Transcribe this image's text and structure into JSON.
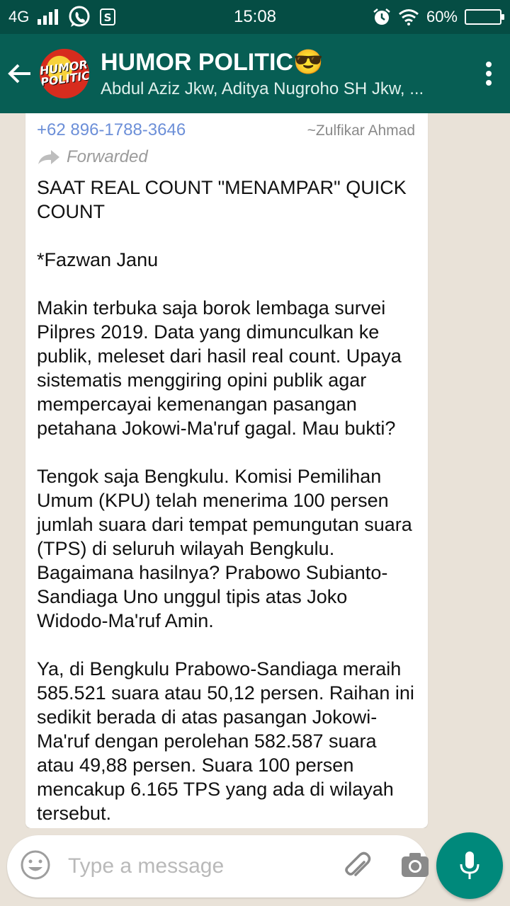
{
  "status_bar": {
    "network": "4G",
    "time": "15:08",
    "battery": "60%"
  },
  "header": {
    "avatar_text": "HUMOR POLITIC",
    "title": "HUMOR POLITIC😎",
    "subtitle": "Abdul Aziz Jkw, Aditya Nugroho SH Jkw, ..."
  },
  "message": {
    "sender_phone": "+62 896-1788-3646",
    "sender_name": "~Zulfikar Ahmad",
    "forwarded_label": "Forwarded",
    "text": "SAAT REAL COUNT \"MENAMPAR\" QUICK COUNT\n\n*Fazwan Janu\n\nMakin terbuka saja borok lembaga survei Pilpres 2019. Data yang dimunculkan ke publik, meleset dari hasil real count. Upaya sistematis menggiring opini publik agar mempercayai kemenangan pasangan petahana Jokowi-Ma'ruf gagal. Mau bukti?\n\nTengok saja Bengkulu. Komisi Pemilihan Umum (KPU) telah menerima 100 persen jumlah suara dari tempat pemungutan suara (TPS) di seluruh wilayah Bengkulu. Bagaimana hasilnya? Prabowo Subianto-Sandiaga Uno unggul tipis atas Joko Widodo-Ma'ruf Amin.\n\nYa, di Bengkulu Prabowo-Sandiaga meraih 585.521 suara atau 50,12 persen. Raihan ini sedikit berada di atas pasangan Jokowi-Ma'ruf dengan perolehan 582.587 suara atau 49,88 persen. Suara 100 persen mencakup 6.165 TPS yang ada di wilayah tersebut."
  },
  "composer": {
    "placeholder": "Type a message"
  },
  "colors": {
    "status_bar": "#054d44",
    "header": "#075e54",
    "accent": "#00897b",
    "chat_bg": "#e9e2d8"
  }
}
